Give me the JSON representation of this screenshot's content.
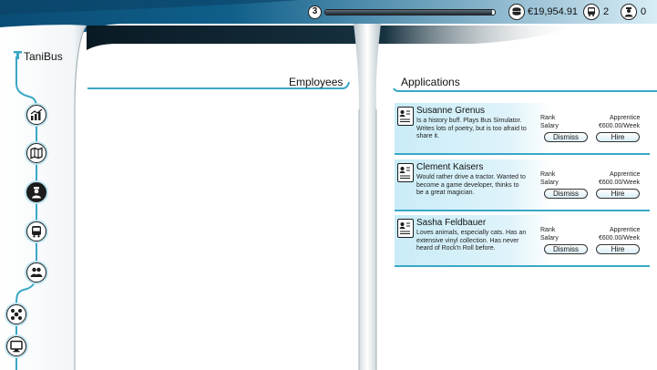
{
  "app": {
    "brand": "TaniBus"
  },
  "resources": {
    "level": "3",
    "xp_progress": 0.985,
    "money": "€19,954.91",
    "buses": "2",
    "staff": "0"
  },
  "employees": {
    "title": "Employees"
  },
  "applications": {
    "title": "Applications",
    "rank_label": "Rank",
    "salary_label": "Salary",
    "dismiss_label": "Dismiss",
    "hire_label": "Hire",
    "items": [
      {
        "name": "Susanne Grenus",
        "bio": "Is a history buff. Plays Bus Simulator. Writes lots of poetry, but is too afraid to share it.",
        "rank": "Apprentice",
        "salary": "€600.00/Week"
      },
      {
        "name": "Clement Kaisers",
        "bio": "Would rather drive a tractor. Wanted to become a game developer, thinks to be a great magician.",
        "rank": "Apprentice",
        "salary": "€600.00/Week"
      },
      {
        "name": "Sasha Feldbauer",
        "bio": "Loves animals, especially cats. Has an extensive vinyl collection. Has never heard of Rock'n Roll before.",
        "rank": "Apprentice",
        "salary": "€600.00/Week"
      }
    ]
  },
  "nav": [
    "chart-icon",
    "map-icon",
    "driver-icon",
    "bus-icon",
    "people-icon",
    "network-icon",
    "monitor-icon"
  ],
  "colors": {
    "accent": "#39a8c6",
    "dark": "#1c1c1c",
    "card_tint": "#c9ecf7"
  }
}
